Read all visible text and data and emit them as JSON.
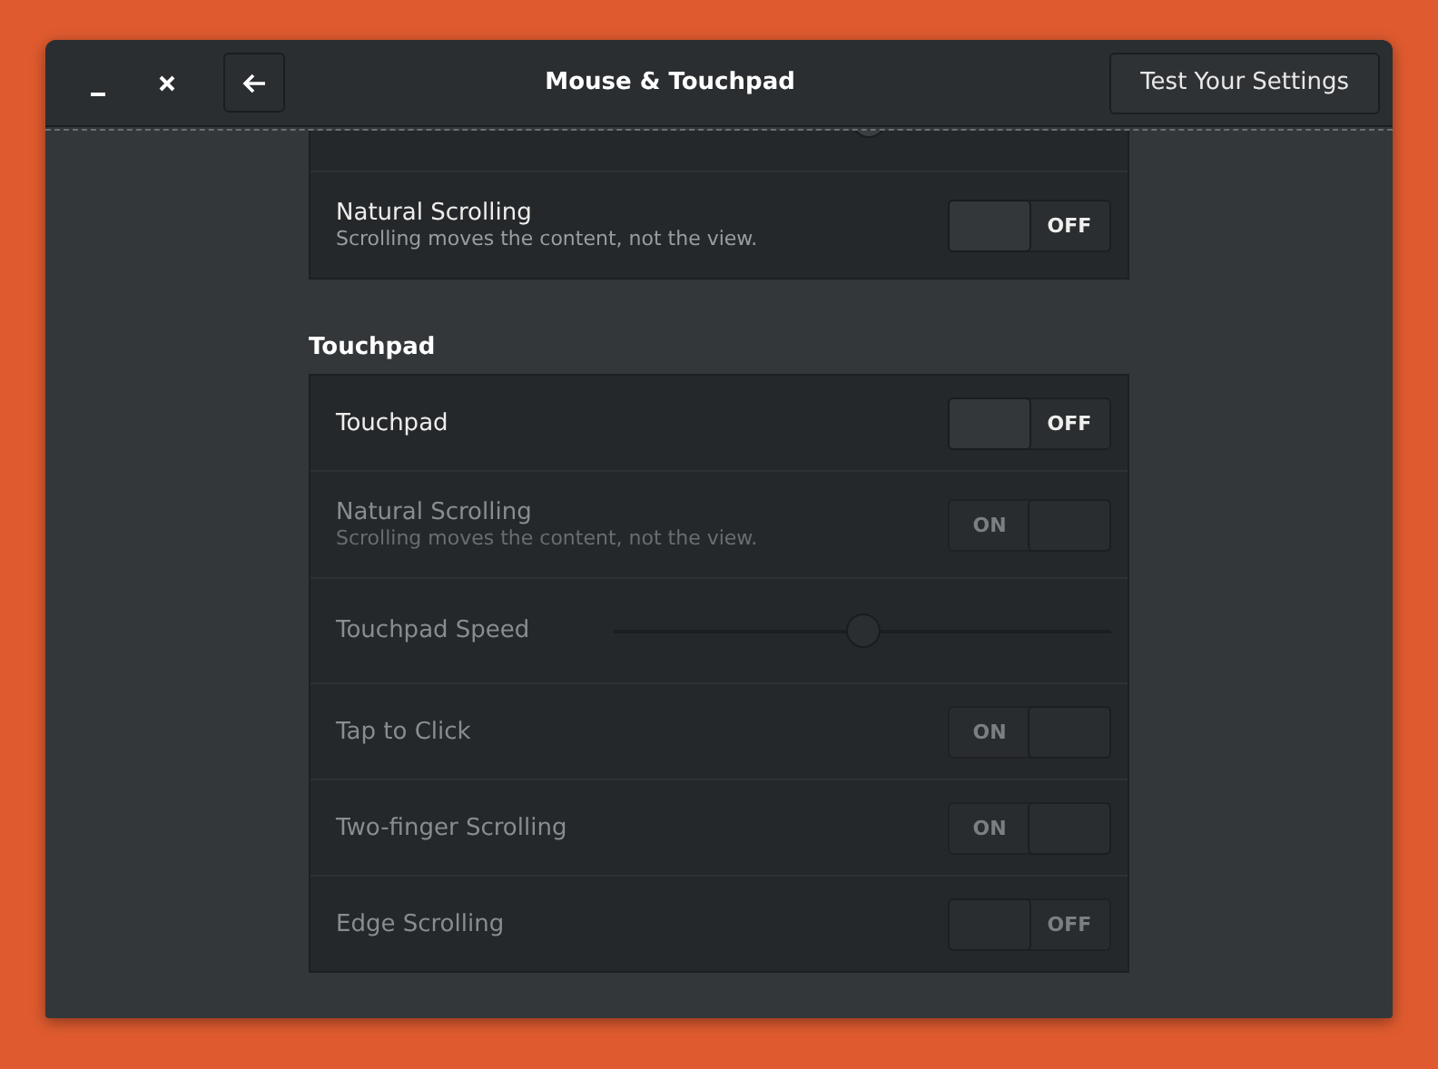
{
  "window": {
    "title": "Mouse & Touchpad",
    "action_button": "Test Your Settings"
  },
  "mouse": {
    "speed": {
      "level": 0.5
    },
    "rows": [
      {
        "kind": "switch",
        "label": "Natural Scrolling",
        "description": "Scrolling moves the content, not the view.",
        "on": false,
        "state_text": "OFF",
        "disabled": false
      }
    ]
  },
  "touchpad": {
    "heading": "Touchpad",
    "rows": [
      {
        "kind": "switch",
        "label": "Touchpad",
        "on": false,
        "state_text": "OFF",
        "disabled": false
      },
      {
        "kind": "switch",
        "label": "Natural Scrolling",
        "description": "Scrolling moves the content, not the view.",
        "on": true,
        "state_text": "ON",
        "disabled": true
      },
      {
        "kind": "slider",
        "label": "Touchpad Speed",
        "level": 0.5,
        "disabled": true
      },
      {
        "kind": "switch",
        "label": "Tap to Click",
        "on": true,
        "state_text": "ON",
        "disabled": true
      },
      {
        "kind": "switch",
        "label": "Two-finger Scrolling",
        "on": true,
        "state_text": "ON",
        "disabled": true
      },
      {
        "kind": "switch",
        "label": "Edge Scrolling",
        "on": false,
        "state_text": "OFF",
        "disabled": true
      }
    ]
  }
}
